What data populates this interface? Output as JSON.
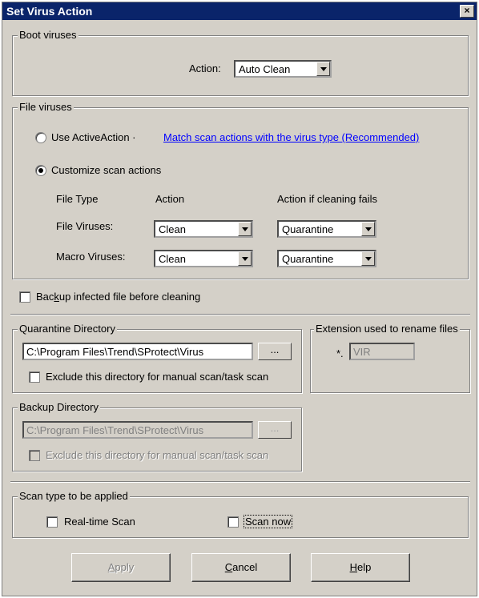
{
  "window": {
    "title": "Set Virus Action",
    "close_label": "×"
  },
  "boot": {
    "title": "Boot viruses",
    "action_label": "Action:",
    "action_value": "Auto Clean"
  },
  "file": {
    "title": "File viruses",
    "use_active_label": "Use ActiveAction ·",
    "use_active_link": "Match scan actions with the virus type (Recommended)",
    "customize_label": "Customize scan actions",
    "col_file_type": "File Type",
    "col_action": "Action",
    "col_fail": "Action if cleaning fails",
    "rows": [
      {
        "label": "File Viruses:",
        "action": "Clean",
        "fail": "Quarantine"
      },
      {
        "label": "Macro Viruses:",
        "action": "Clean",
        "fail": "Quarantine"
      }
    ]
  },
  "backup_infected": {
    "pre": "Bac",
    "key": "k",
    "post": "up infected file before cleaning"
  },
  "quarantine": {
    "title": "Quarantine Directory",
    "path": "C:\\Program Files\\Trend\\SProtect\\Virus",
    "browse": "...",
    "exclude_label": "Exclude this directory for manual scan/task scan"
  },
  "extension": {
    "title": "Extension used to rename files",
    "prefix": "*.",
    "value": "VIR"
  },
  "backup_dir": {
    "title": "Backup Directory",
    "path": "C:\\Program Files\\Trend\\SProtect\\Virus",
    "browse": "...",
    "exclude_label": "Exclude this directory for manual scan/task scan"
  },
  "scan_type": {
    "title": "Scan type to be applied",
    "realtime_label": "Real-time Scan",
    "scan_now_label": "Scan now"
  },
  "buttons": {
    "apply": {
      "key": "A",
      "rest": "pply"
    },
    "cancel": {
      "key": "C",
      "rest": "ancel"
    },
    "help": {
      "key": "H",
      "rest": "elp"
    }
  }
}
